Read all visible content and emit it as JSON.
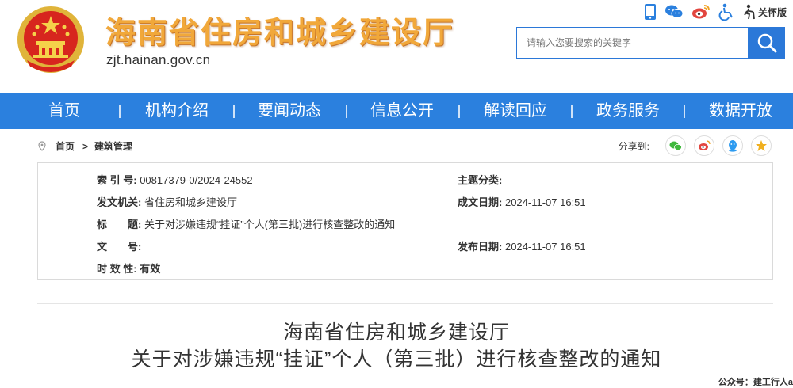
{
  "header": {
    "site_title": "海南省住房和城乡建设厅",
    "site_domain": "zjt.hainan.gov.cn",
    "elder_mode_label": "关怀版",
    "search_placeholder": "请输入您要搜索的关键字"
  },
  "tools": [
    "mobile-icon",
    "wechat-icon",
    "weibo-icon",
    "accessibility-icon",
    "elder-mode-icon"
  ],
  "nav": {
    "items": [
      "首页",
      "机构介绍",
      "要闻动态",
      "信息公开",
      "解读回应",
      "政务服务",
      "数据开放"
    ]
  },
  "breadcrumb": {
    "home": "首页",
    "arrow": ">",
    "current": "建筑管理"
  },
  "share": {
    "label": "分享到:",
    "targets": [
      "wechat",
      "weibo",
      "qq",
      "qzone"
    ]
  },
  "info": {
    "index_label": "索 引 号:",
    "index_value": "00817379-0/2024-24552",
    "topic_label": "主题分类:",
    "topic_value": "",
    "issuer_label": "发文机关:",
    "issuer_value": "省住房和城乡建设厅",
    "created_label": "成文日期:",
    "created_value": "2024-11-07 16:51",
    "title_label": "标　　题:",
    "title_value": "关于对涉嫌违规“挂证”个人(第三批)进行核查整改的通知",
    "docno_label": "文　　号:",
    "docno_value": "",
    "published_label": "发布日期:",
    "published_value": "2024-11-07 16:51",
    "validity_label": "时 效 性:",
    "validity_value": "有效"
  },
  "document": {
    "title_line1": "海南省住房和城乡建设厅",
    "title_line2": "关于对涉嫌违规“挂证”个人（第三批）进行核查整改的通知"
  },
  "watermark": "公众号：建工行人a",
  "colors": {
    "nav_blue": "#2b80de",
    "brand_orange": "#f1a83a",
    "emblem_red": "#d7261e",
    "share_green": "#3fb83c",
    "share_red": "#e2463f",
    "share_blue": "#2d9bf0",
    "share_yellow": "#f0b020"
  }
}
